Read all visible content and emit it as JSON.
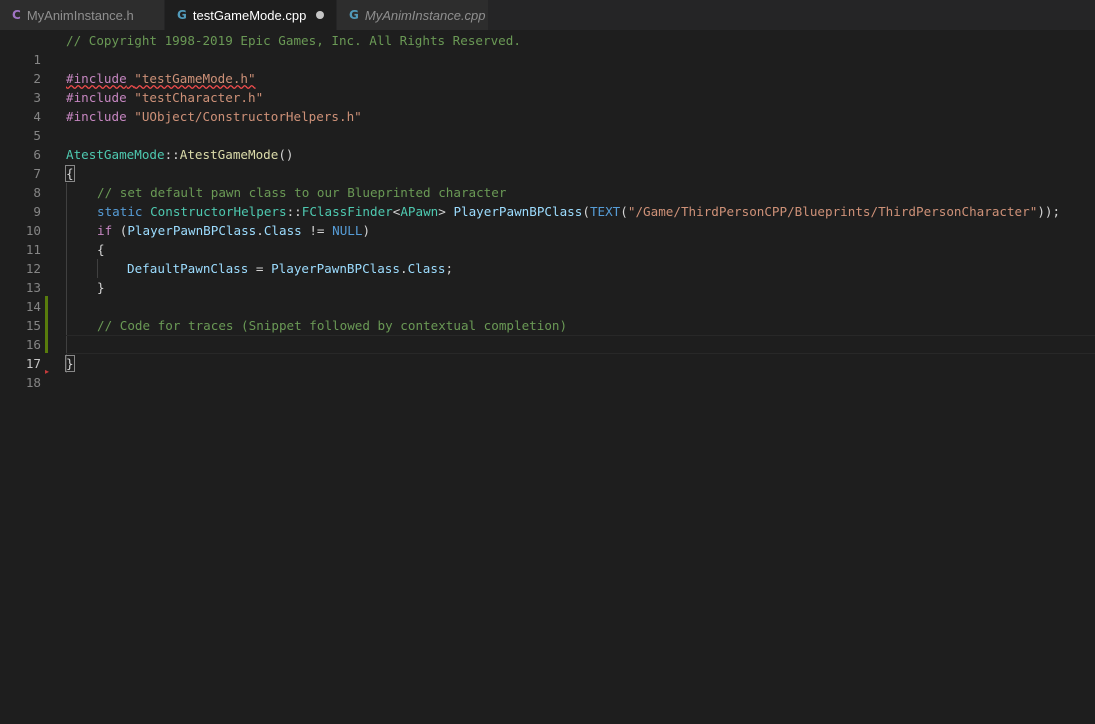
{
  "tabs": [
    {
      "label": "MyAnimInstance.h",
      "icon": "c-header-icon",
      "glyph": "C"
    },
    {
      "label": "testGameMode.cpp",
      "icon": "cpp-file-icon",
      "glyph": "G"
    },
    {
      "label": "MyAnimInstance.cpp",
      "icon": "cpp-file-icon",
      "glyph": "G"
    }
  ],
  "line_numbers": [
    "1",
    "2",
    "3",
    "4",
    "5",
    "6",
    "7",
    "8",
    "9",
    "10",
    "11",
    "12",
    "13",
    "14",
    "15",
    "16",
    "17",
    "18"
  ],
  "code": {
    "l1": "// Copyright 1998-2019 Epic Games, Inc. All Rights Reserved.",
    "l3_kw": "#include",
    "l3_str": "\"testGameMode.h\"",
    "l4_kw": "#include",
    "l4_str": "\"testCharacter.h\"",
    "l5_kw": "#include",
    "l5_str": "\"UObject/ConstructorHelpers.h\"",
    "l7_class": "AtestGameMode",
    "l7_sep": "::",
    "l7_fn": "AtestGameMode",
    "l7_paren": "()",
    "l8": "{",
    "l9": "// set default pawn class to our Blueprinted character",
    "l10_static": "static",
    "l10_class": "ConstructorHelpers",
    "l10_sep": "::",
    "l10_type": "FClassFinder",
    "l10_lt": "<",
    "l10_apawn": "APawn",
    "l10_gt": "> ",
    "l10_fn": "PlayerPawnBPClass",
    "l10_open": "(",
    "l10_text": "TEXT",
    "l10_open2": "(",
    "l10_str": "\"/Game/ThirdPersonCPP/Blueprints/ThirdPersonCharacter\"",
    "l10_close": "));",
    "l11_if": "if",
    "l11_open": " (",
    "l11_var": "PlayerPawnBPClass",
    "l11_dot": ".",
    "l11_member": "Class",
    "l11_op": " != ",
    "l11_null": "NULL",
    "l11_close": ")",
    "l12": "{",
    "l13_var": "DefaultPawnClass",
    "l13_eq": " = ",
    "l13_obj": "PlayerPawnBPClass",
    "l13_dot": ".",
    "l13_member": "Class",
    "l13_semi": ";",
    "l14": "}",
    "l16": "// Code for traces (Snippet followed by contextual completion)",
    "l18": "}"
  },
  "colors": {
    "background": "#1e1e1e",
    "comment": "#6a9955",
    "string": "#ce9178",
    "keyword": "#569cd6",
    "type": "#4ec9b0",
    "function": "#dcdcaa",
    "variable": "#9cdcfe",
    "modified_gutter": "#587c0c"
  }
}
